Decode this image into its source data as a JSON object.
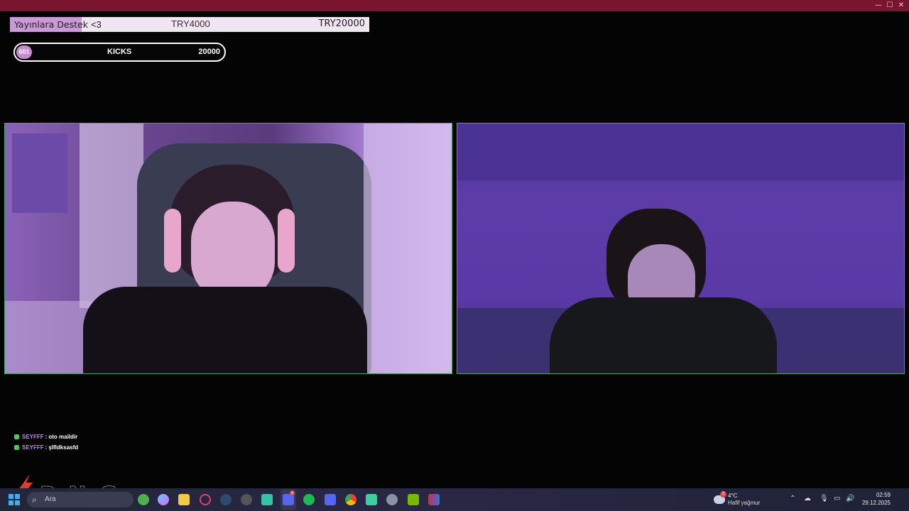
{
  "window": {
    "controls": [
      "—",
      "☐",
      "✕"
    ]
  },
  "donation_goal": {
    "label": "Yayınlara Destek",
    "heart": "<3",
    "current_amount": "TRY4000",
    "target_amount": "TRY20000",
    "progress_fraction": 0.2,
    "fill_color": "#c99ad6"
  },
  "kicks_goal": {
    "current": "601",
    "label": "KICKS",
    "goal": "20000",
    "accent_color": "#c58ad1"
  },
  "cameras": [
    {
      "description_name": "left-webcam",
      "border_color": "#3ea66a"
    },
    {
      "description_name": "right-webcam",
      "border_color": "#3ea66a"
    }
  ],
  "chat": [
    {
      "user": "SEYFFF",
      "separator": ":",
      "message": "oto maildir"
    },
    {
      "user": "SEYFFF",
      "separator": ":",
      "message": "şlfldksasfd"
    }
  ],
  "watermark": {
    "text": "ByNoGame"
  },
  "taskbar": {
    "search_placeholder": "Ara",
    "icons": [
      "windows-start-icon",
      "xbox-icon",
      "copilot-icon",
      "file-explorer-icon",
      "opera-gx-icon",
      "steam-icon",
      "github-icon",
      "app-icon",
      "discord-icon",
      "spotify-icon",
      "discord-alt-icon",
      "chrome-icon",
      "discord-ptb-icon",
      "settings-icon",
      "nvidia-icon",
      "winrar-icon"
    ],
    "discord_badge": "6",
    "weather": {
      "badge": "3",
      "temperature": "4°C",
      "description": "Hafif yağmur"
    },
    "tray_icons": [
      "chevron-up-icon",
      "cloud-off-icon",
      "microphone-icon",
      "network-icon",
      "speaker-icon"
    ],
    "time": "02:59",
    "date": "29.12.2025"
  }
}
